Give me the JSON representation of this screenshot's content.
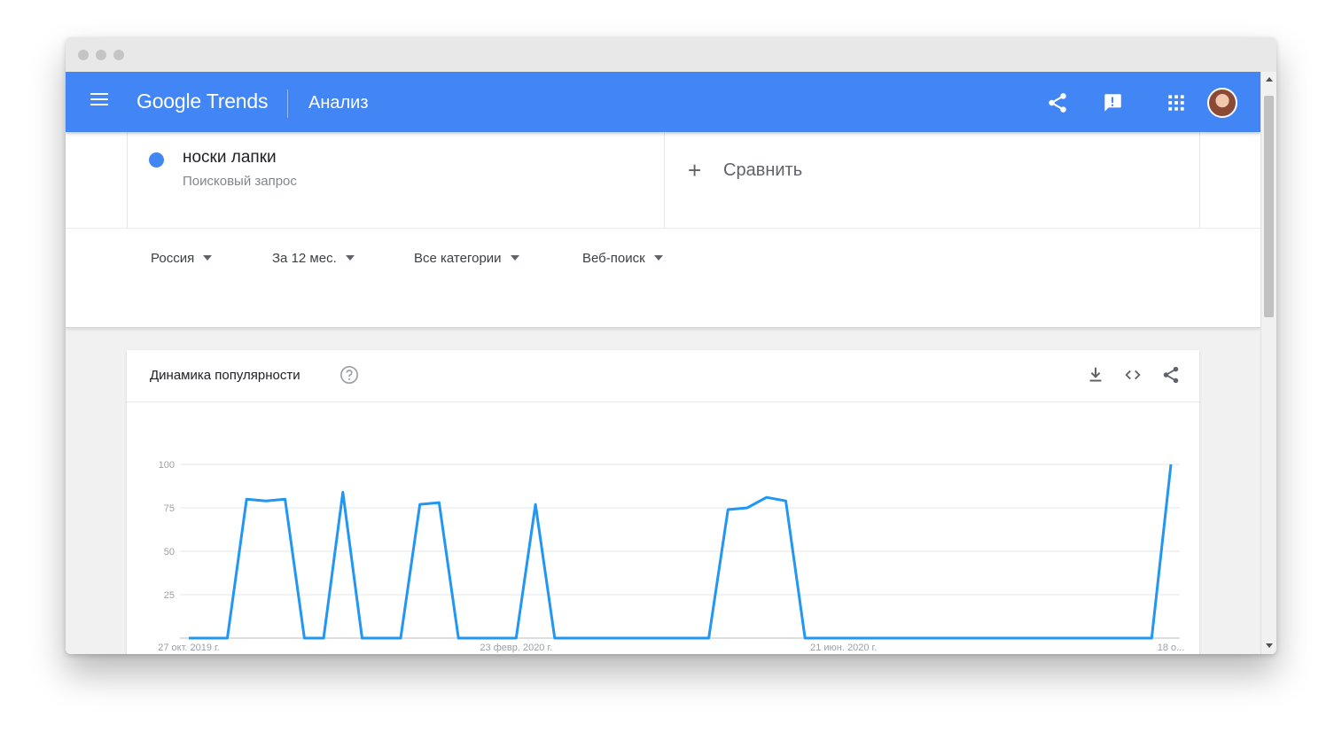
{
  "app": {
    "logo": "Google Trends",
    "page_title": "Анализ",
    "icons": [
      "menu-icon",
      "share-icon",
      "feedback-icon",
      "apps-icon",
      "avatar"
    ],
    "accent_color": "#4285f4"
  },
  "search": {
    "term": "носки лапки",
    "term_type": "Поисковый запрос",
    "term_color": "#4285f4",
    "compare_label": "Сравнить"
  },
  "filters": [
    "Россия",
    "За 12 мес.",
    "Все категории",
    "Веб-поиск"
  ],
  "chart_card": {
    "title": "Динамика популярности",
    "actions": [
      "download-icon",
      "embed-icon",
      "share-icon"
    ]
  },
  "chart_data": {
    "type": "line",
    "title": "",
    "xlabel": "",
    "ylabel": "",
    "ylim": [
      0,
      100
    ],
    "yticks": [
      25,
      50,
      75,
      100
    ],
    "grid": true,
    "x_tick_labels": [
      {
        "index": 0,
        "label": "27 окт. 2019 г."
      },
      {
        "index": 17,
        "label": "23 февр. 2020 г."
      },
      {
        "index": 34,
        "label": "21 июн. 2020 г."
      },
      {
        "index": 51,
        "label": "18 о..."
      }
    ],
    "x": [
      "2019-10-27",
      "2019-11-03",
      "2019-11-10",
      "2019-11-17",
      "2019-11-24",
      "2019-12-01",
      "2019-12-08",
      "2019-12-15",
      "2019-12-22",
      "2019-12-29",
      "2020-01-05",
      "2020-01-12",
      "2020-01-19",
      "2020-01-26",
      "2020-02-02",
      "2020-02-09",
      "2020-02-16",
      "2020-02-23",
      "2020-03-01",
      "2020-03-08",
      "2020-03-15",
      "2020-03-22",
      "2020-03-29",
      "2020-04-05",
      "2020-04-12",
      "2020-04-19",
      "2020-04-26",
      "2020-05-03",
      "2020-05-10",
      "2020-05-17",
      "2020-05-24",
      "2020-05-31",
      "2020-06-07",
      "2020-06-14",
      "2020-06-21",
      "2020-06-28",
      "2020-07-05",
      "2020-07-12",
      "2020-07-19",
      "2020-07-26",
      "2020-08-02",
      "2020-08-09",
      "2020-08-16",
      "2020-08-23",
      "2020-08-30",
      "2020-09-06",
      "2020-09-13",
      "2020-09-20",
      "2020-09-27",
      "2020-10-04",
      "2020-10-11",
      "2020-10-18"
    ],
    "series": [
      {
        "color": "#2196f3",
        "values": [
          0,
          0,
          0,
          80,
          79,
          80,
          0,
          0,
          84,
          0,
          0,
          0,
          77,
          78,
          0,
          0,
          0,
          0,
          77,
          0,
          0,
          0,
          0,
          0,
          0,
          0,
          0,
          0,
          74,
          75,
          81,
          79,
          0,
          0,
          0,
          0,
          0,
          0,
          0,
          0,
          0,
          0,
          0,
          0,
          0,
          0,
          0,
          0,
          0,
          0,
          0,
          100
        ]
      }
    ]
  }
}
